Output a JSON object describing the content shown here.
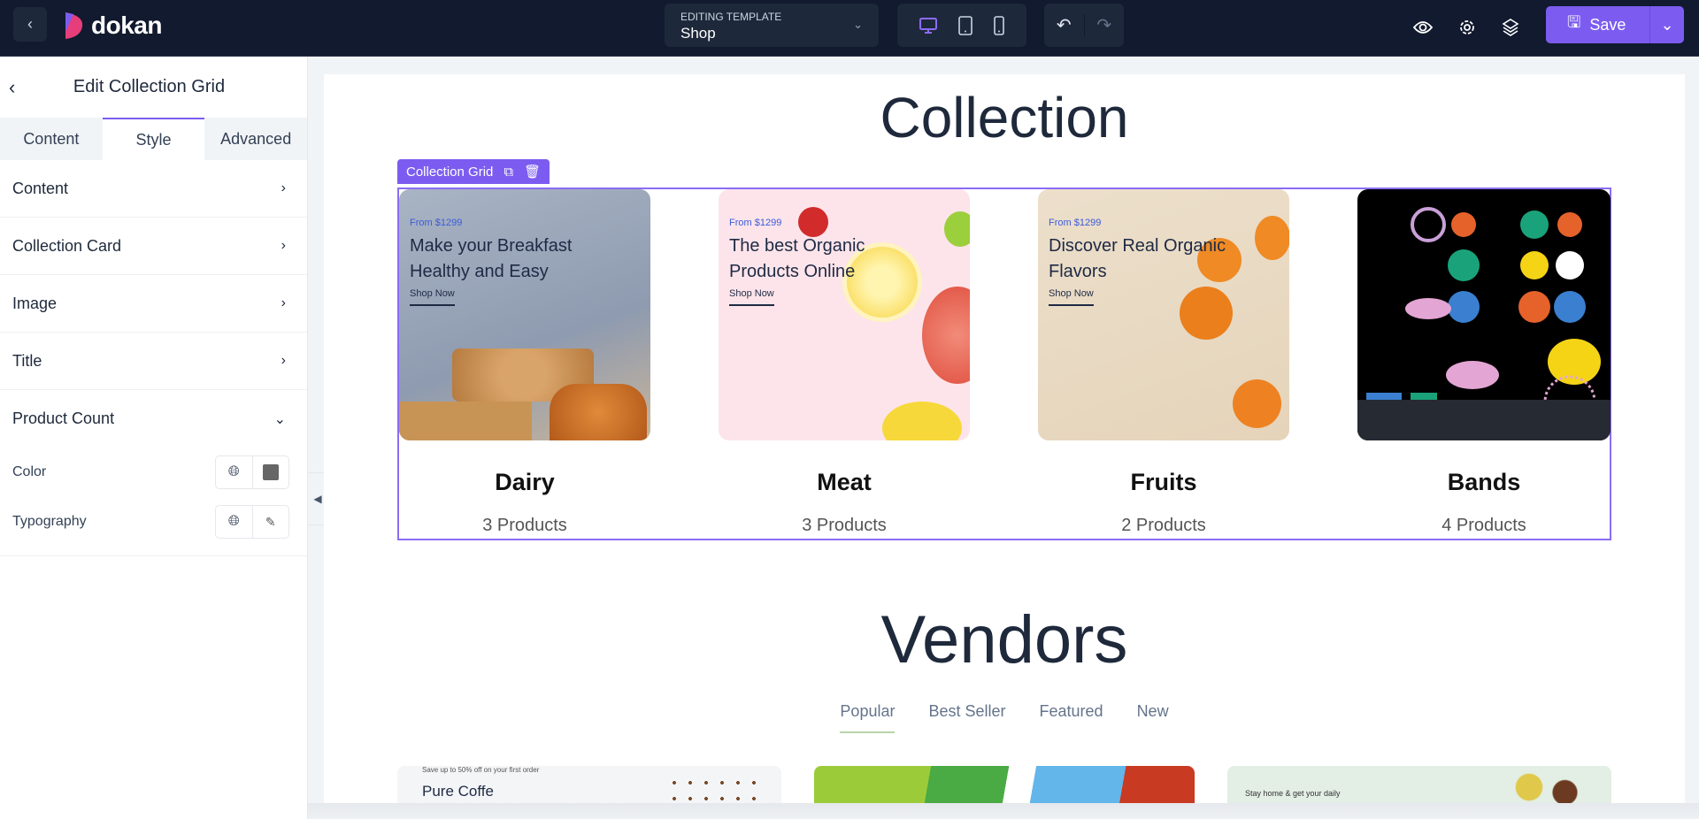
{
  "topbar": {
    "brand": "dokan",
    "template_label": "EDITING TEMPLATE",
    "template_value": "Shop",
    "save_label": "Save",
    "accent": "#7c5cf0"
  },
  "sidebar": {
    "title": "Edit Collection Grid",
    "tabs": [
      {
        "label": "Content"
      },
      {
        "label": "Style",
        "active": true
      },
      {
        "label": "Advanced"
      }
    ],
    "sections": [
      {
        "label": "Content"
      },
      {
        "label": "Collection Card"
      },
      {
        "label": "Image"
      },
      {
        "label": "Title"
      }
    ],
    "expanded": {
      "label": "Product Count",
      "props": [
        {
          "label": "Color",
          "swatch": "#666666"
        },
        {
          "label": "Typography"
        }
      ]
    }
  },
  "canvas": {
    "collection_title": "Collection",
    "element_tag": "Collection Grid",
    "cards": [
      {
        "from": "From $1299",
        "headline": "Make your Breakfast Healthy and Easy",
        "shop": "Shop Now",
        "name": "Dairy",
        "count": "3 Products"
      },
      {
        "from": "From $1299",
        "headline": "The best Organic Products Online",
        "shop": "Shop Now",
        "name": "Meat",
        "count": "3 Products"
      },
      {
        "from": "From $1299",
        "headline": "Discover Real Organic Flavors",
        "shop": "Shop Now",
        "name": "Fruits",
        "count": "2 Products"
      },
      {
        "name": "Bands",
        "count": "4 Products"
      }
    ],
    "vendors_title": "Vendors",
    "vendor_tabs": [
      {
        "label": "Popular",
        "active": true
      },
      {
        "label": "Best Seller"
      },
      {
        "label": "Featured"
      },
      {
        "label": "New"
      }
    ],
    "vendor_cards": [
      {
        "promo": "Save up to 50% off on your first order",
        "title": "Pure Coffe"
      },
      {},
      {
        "promo": "Stay home & get your daily"
      }
    ]
  }
}
